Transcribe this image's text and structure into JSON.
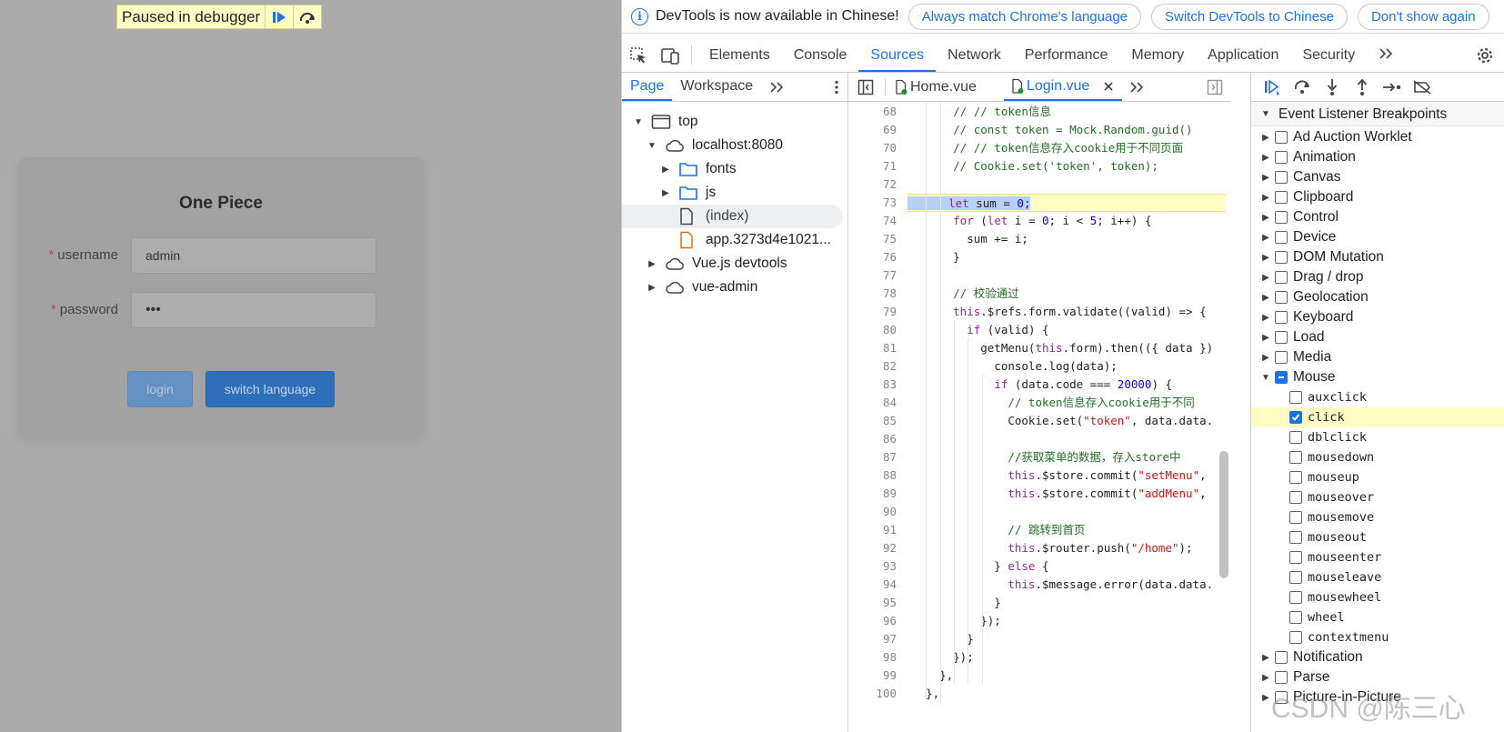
{
  "page": {
    "paused_label": "Paused in debugger",
    "title": "One Piece",
    "username_label": "username",
    "username_value": "admin",
    "password_label": "password",
    "password_value": "•••",
    "required_mark": "*",
    "login_label": "login",
    "switch_label": "switch language"
  },
  "infobar": {
    "message": "DevTools is now available in Chinese!",
    "btn_match": "Always match Chrome's language",
    "btn_switch": "Switch DevTools to Chinese",
    "btn_dismiss": "Don't show again"
  },
  "main_tabs": [
    "Elements",
    "Console",
    "Sources",
    "Network",
    "Performance",
    "Memory",
    "Application",
    "Security"
  ],
  "active_main_tab": "Sources",
  "navigator": {
    "tabs": [
      "Page",
      "Workspace"
    ],
    "tree": [
      "top",
      "localhost:8080",
      "fonts",
      "js",
      "(index)",
      "app.3273d4e1021...",
      "Vue.js devtools",
      "vue-admin"
    ]
  },
  "editor": {
    "tabs": [
      "Home.vue",
      "Login.vue"
    ],
    "line_numbers": [
      "68",
      "69",
      "70",
      "71",
      "72",
      "73",
      "74",
      "75",
      "76",
      "77",
      "78",
      "79",
      "80",
      "81",
      "82",
      "83",
      "84",
      "85",
      "86",
      "87",
      "88",
      "89",
      "90",
      "91",
      "92",
      "93",
      "94",
      "95",
      "96",
      "97",
      "98",
      "99",
      "100"
    ],
    "lines": [
      "      // // token信息",
      "      // const token = Mock.Random.guid()",
      "      // // token信息存入cookie用于不同页面",
      "      // Cookie.set('token', token);",
      "",
      "      let sum = 0;",
      "      for (let i = 0; i < 5; i++) {",
      "        sum += i;",
      "      }",
      "",
      "      // 校验通过",
      "      this.$refs.form.validate((valid) => {",
      "        if (valid) {",
      "          getMenu(this.form).then(({ data })",
      "            console.log(data);",
      "            if (data.code === 20000) {",
      "              // token信息存入cookie用于不同",
      "              Cookie.set(\"token\", data.data.",
      "",
      "              //获取菜单的数据，存入store中",
      "              this.$store.commit(\"setMenu\",",
      "              this.$store.commit(\"addMenu\",",
      "",
      "              // 跳转到首页",
      "              this.$router.push(\"/home\");",
      "            } else {",
      "              this.$message.error(data.data.",
      "            }",
      "          });",
      "        }",
      "      });",
      "    },",
      "  },"
    ]
  },
  "debug": {
    "section_title": "Event Listener Breakpoints",
    "categories_top": [
      "Ad Auction Worklet",
      "Animation",
      "Canvas",
      "Clipboard",
      "Control",
      "Device",
      "DOM Mutation",
      "Drag / drop",
      "Geolocation",
      "Keyboard",
      "Load",
      "Media"
    ],
    "mouse_label": "Mouse",
    "mouse_events": [
      "auxclick",
      "click",
      "dblclick",
      "mousedown",
      "mouseup",
      "mouseover",
      "mousemove",
      "mouseout",
      "mouseenter",
      "mouseleave",
      "mousewheel",
      "wheel",
      "contextmenu"
    ],
    "checked_event": "click",
    "categories_bottom": [
      "Notification",
      "Parse",
      "Picture-in-Picture"
    ]
  },
  "watermark": "CSDN @陈三心"
}
